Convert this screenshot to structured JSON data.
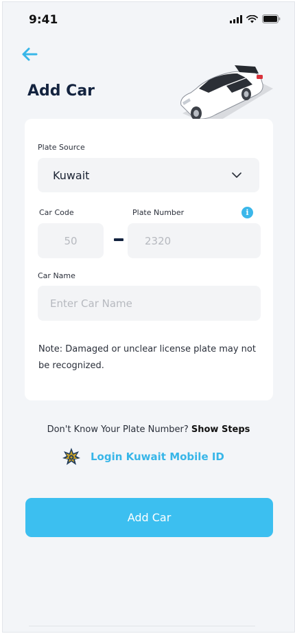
{
  "status_bar": {
    "time": "9:41"
  },
  "header": {
    "title": "Add Car"
  },
  "form": {
    "plate_source_label": "Plate Source",
    "plate_source_value": "Kuwait",
    "car_code_label": "Car Code",
    "plate_number_label": "Plate Number",
    "car_code_placeholder": "50",
    "plate_number_placeholder": "2320",
    "separator": "-",
    "car_name_label": "Car Name",
    "car_name_placeholder": "Enter Car Name",
    "note": "Note: Damaged or unclear license plate may not be recognized."
  },
  "help": {
    "question": "Don't Know Your  Plate Number? ",
    "link": "Show Steps"
  },
  "login": {
    "label": "Login Kuwait Mobile ID"
  },
  "actions": {
    "add_car_label": "Add Car"
  },
  "colors": {
    "accent": "#3cbff0",
    "title": "#13233f",
    "field_bg": "#f3f4f6"
  },
  "icons": {
    "back": "arrow-left-icon",
    "dropdown": "chevron-down-icon",
    "info": "info-icon",
    "kuwait_id": "kuwait-emblem-icon"
  }
}
